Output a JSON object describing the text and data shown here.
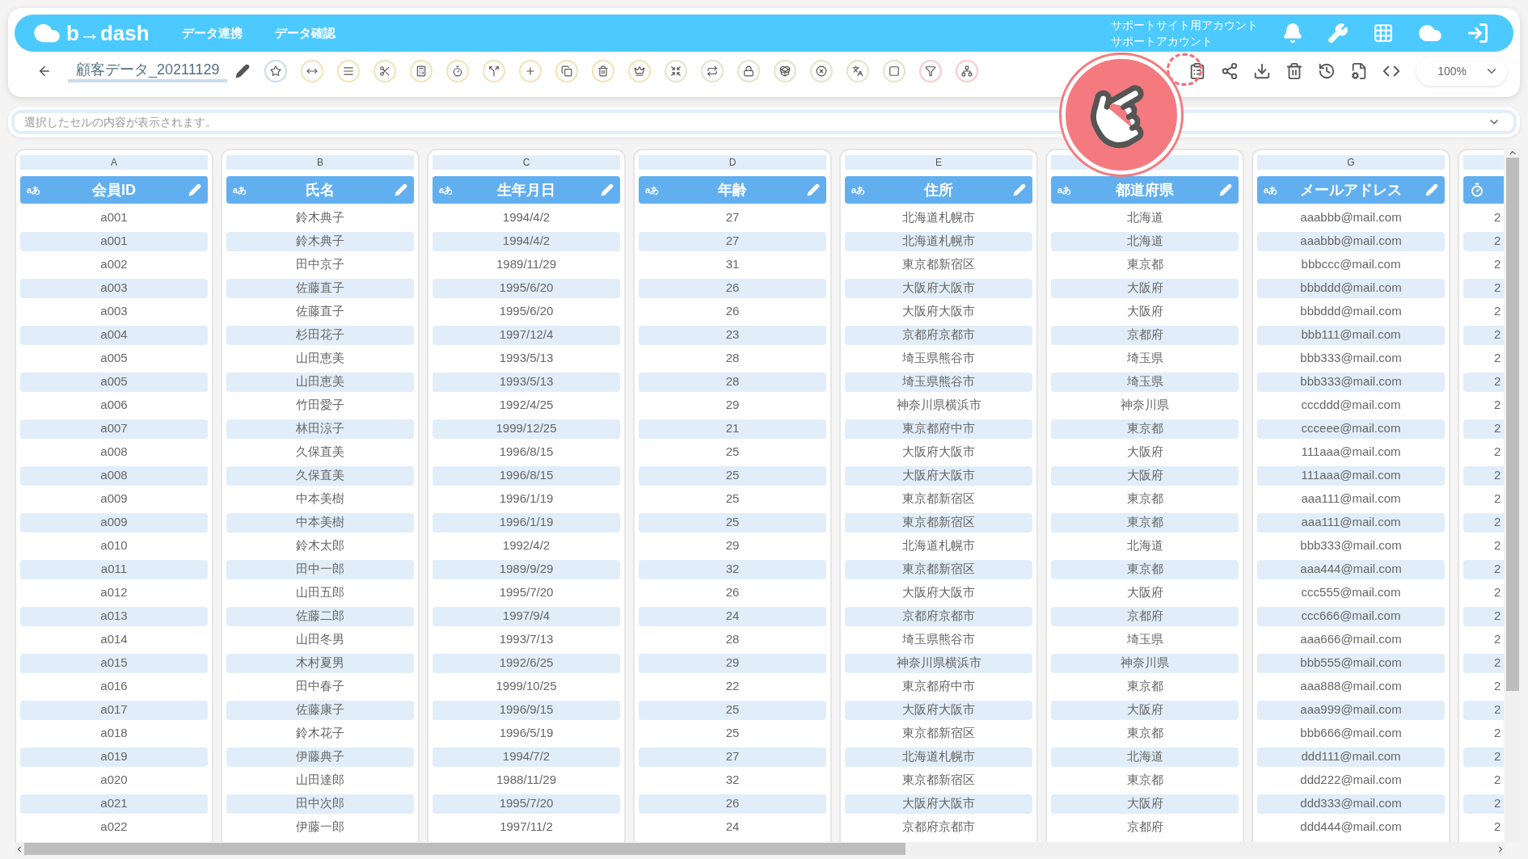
{
  "header": {
    "logo": "b→dash",
    "nav": [
      "データ連携",
      "データ確認"
    ],
    "account": [
      "サポートサイト用アカウント",
      "サポートアカウント"
    ]
  },
  "toolbar": {
    "title": "顧客データ_20211129",
    "zoom": "100%"
  },
  "cell_bar": {
    "placeholder": "選択したセルの内容が表示されます。"
  },
  "columns": [
    {
      "letter": "A",
      "title": "会員ID",
      "kind": "text",
      "type_label": "aあ"
    },
    {
      "letter": "B",
      "title": "氏名",
      "kind": "text",
      "type_label": "aあ"
    },
    {
      "letter": "C",
      "title": "生年月日",
      "kind": "text",
      "type_label": "aあ"
    },
    {
      "letter": "D",
      "title": "年齢",
      "kind": "text",
      "type_label": "aあ"
    },
    {
      "letter": "E",
      "title": "住所",
      "kind": "text",
      "type_label": "aあ"
    },
    {
      "title": "都道府県",
      "kind": "text",
      "type_label": "aあ"
    },
    {
      "letter": "G",
      "title": "メールアドレス",
      "kind": "text",
      "type_label": "aあ"
    },
    {
      "kind": "timer"
    }
  ],
  "rows": [
    [
      "a001",
      "鈴木典子",
      "1994/4/2",
      "27",
      "北海道札幌市",
      "北海道",
      "aaabbb@mail.com",
      "2"
    ],
    [
      "a001",
      "鈴木典子",
      "1994/4/2",
      "27",
      "北海道札幌市",
      "北海道",
      "aaabbb@mail.com",
      "2"
    ],
    [
      "a002",
      "田中京子",
      "1989/11/29",
      "31",
      "東京都新宿区",
      "東京都",
      "bbbccc@mail.com",
      "2"
    ],
    [
      "a003",
      "佐藤直子",
      "1995/6/20",
      "26",
      "大阪府大阪市",
      "大阪府",
      "bbbddd@mail.com",
      "2"
    ],
    [
      "a003",
      "佐藤直子",
      "1995/6/20",
      "26",
      "大阪府大阪市",
      "大阪府",
      "bbbddd@mail.com",
      "2"
    ],
    [
      "a004",
      "杉田花子",
      "1997/12/4",
      "23",
      "京都府京都市",
      "京都府",
      "bbb111@mail.com",
      "2"
    ],
    [
      "a005",
      "山田恵美",
      "1993/5/13",
      "28",
      "埼玉県熊谷市",
      "埼玉県",
      "bbb333@mail.com",
      "2"
    ],
    [
      "a005",
      "山田恵美",
      "1993/5/13",
      "28",
      "埼玉県熊谷市",
      "埼玉県",
      "bbb333@mail.com",
      "2"
    ],
    [
      "a006",
      "竹田愛子",
      "1992/4/25",
      "29",
      "神奈川県横浜市",
      "神奈川県",
      "cccddd@mail.com",
      "2"
    ],
    [
      "a007",
      "林田涼子",
      "1999/12/25",
      "21",
      "東京都府中市",
      "東京都",
      "ccceee@mail.com",
      "2"
    ],
    [
      "a008",
      "久保直美",
      "1996/8/15",
      "25",
      "大阪府大阪市",
      "大阪府",
      "111aaa@mail.com",
      "2"
    ],
    [
      "a008",
      "久保直美",
      "1996/8/15",
      "25",
      "大阪府大阪市",
      "大阪府",
      "111aaa@mail.com",
      "2"
    ],
    [
      "a009",
      "中本美樹",
      "1996/1/19",
      "25",
      "東京都新宿区",
      "東京都",
      "aaa111@mail.com",
      "2"
    ],
    [
      "a009",
      "中本美樹",
      "1996/1/19",
      "25",
      "東京都新宿区",
      "東京都",
      "aaa111@mail.com",
      "2"
    ],
    [
      "a010",
      "鈴木太郎",
      "1992/4/2",
      "29",
      "北海道札幌市",
      "北海道",
      "bbb333@mail.com",
      "2"
    ],
    [
      "a011",
      "田中一郎",
      "1989/9/29",
      "32",
      "東京都新宿区",
      "東京都",
      "aaa444@mail.com",
      "2"
    ],
    [
      "a012",
      "山田五郎",
      "1995/7/20",
      "26",
      "大阪府大阪市",
      "大阪府",
      "ccc555@mail.com",
      "2"
    ],
    [
      "a013",
      "佐藤二郎",
      "1997/9/4",
      "24",
      "京都府京都市",
      "京都府",
      "ccc666@mail.com",
      "2"
    ],
    [
      "a014",
      "山田冬男",
      "1993/7/13",
      "28",
      "埼玉県熊谷市",
      "埼玉県",
      "aaa666@mail.com",
      "2"
    ],
    [
      "a015",
      "木村夏男",
      "1992/6/25",
      "29",
      "神奈川県横浜市",
      "神奈川県",
      "bbb555@mail.com",
      "2"
    ],
    [
      "a016",
      "田中春子",
      "1999/10/25",
      "22",
      "東京都府中市",
      "東京都",
      "aaa888@mail.com",
      "2"
    ],
    [
      "a017",
      "佐藤康子",
      "1996/9/15",
      "25",
      "大阪府大阪市",
      "大阪府",
      "aaa999@mail.com",
      "2"
    ],
    [
      "a018",
      "鈴木花子",
      "1996/5/19",
      "25",
      "東京都新宿区",
      "東京都",
      "bbb666@mail.com",
      "2"
    ],
    [
      "a019",
      "伊藤典子",
      "1994/7/2",
      "27",
      "北海道札幌市",
      "北海道",
      "ddd111@mail.com",
      "2"
    ],
    [
      "a020",
      "山田達郎",
      "1988/11/29",
      "32",
      "東京都新宿区",
      "東京都",
      "ddd222@mail.com",
      "2"
    ],
    [
      "a021",
      "田中次郎",
      "1995/7/20",
      "26",
      "大阪府大阪市",
      "大阪府",
      "ddd333@mail.com",
      "2"
    ],
    [
      "a022",
      "伊藤一郎",
      "1997/11/2",
      "24",
      "京都府京都市",
      "京都府",
      "ddd444@mail.com",
      "2"
    ]
  ]
}
